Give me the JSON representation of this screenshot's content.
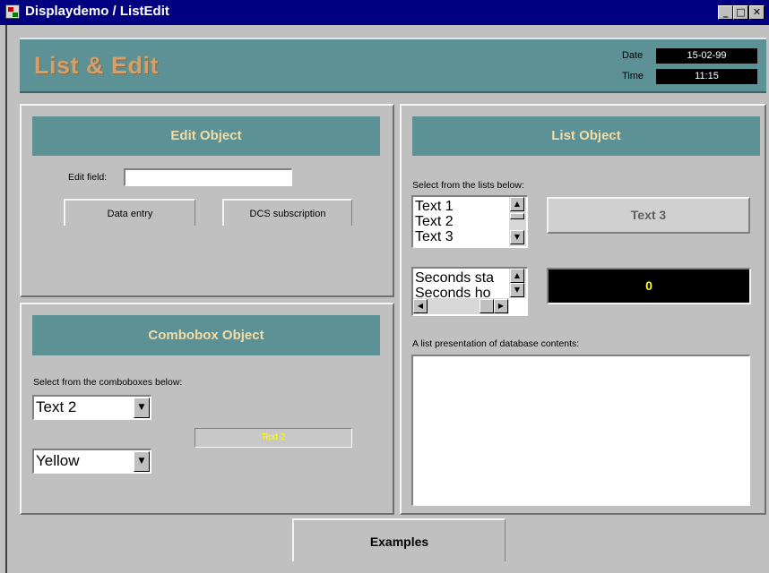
{
  "window": {
    "title": "Displaydemo / ListEdit",
    "min_glyph": "_",
    "max_glyph": "□",
    "close_glyph": "✕"
  },
  "header": {
    "title": "List & Edit",
    "date_label": "Date",
    "date_value": "15-02-99",
    "time_label": "Time",
    "time_value": "11:15"
  },
  "edit_panel": {
    "heading": "Edit Object",
    "field_label": "Edit field:",
    "field_value": "",
    "data_entry_label": "Data entry",
    "dcs_label": "DCS subscription"
  },
  "combo_panel": {
    "heading": "Combobox Object",
    "instruction": "Select from the comboboxes below:",
    "combo1_value": "Text 2",
    "combo2_value": "Yellow",
    "result_text": "Text 2",
    "result_color": "#ffff00"
  },
  "list_panel": {
    "heading": "List Object",
    "instruction": "Select from the lists below:",
    "list1_items": [
      "Text 1",
      "Text 2",
      "Text 3"
    ],
    "list1_selection": "Text 3",
    "list2_items": [
      "Seconds sta",
      "Seconds ho"
    ],
    "counter_value": "0",
    "counter_color": "#ffff00",
    "db_label": "A list presentation of database contents:"
  },
  "footer": {
    "examples_label": "Examples"
  },
  "colors": {
    "titlebar": "#000080",
    "panel_header": "#5c9196",
    "header_title": "#d2a068",
    "panel_heading_text": "#f3dca4"
  }
}
